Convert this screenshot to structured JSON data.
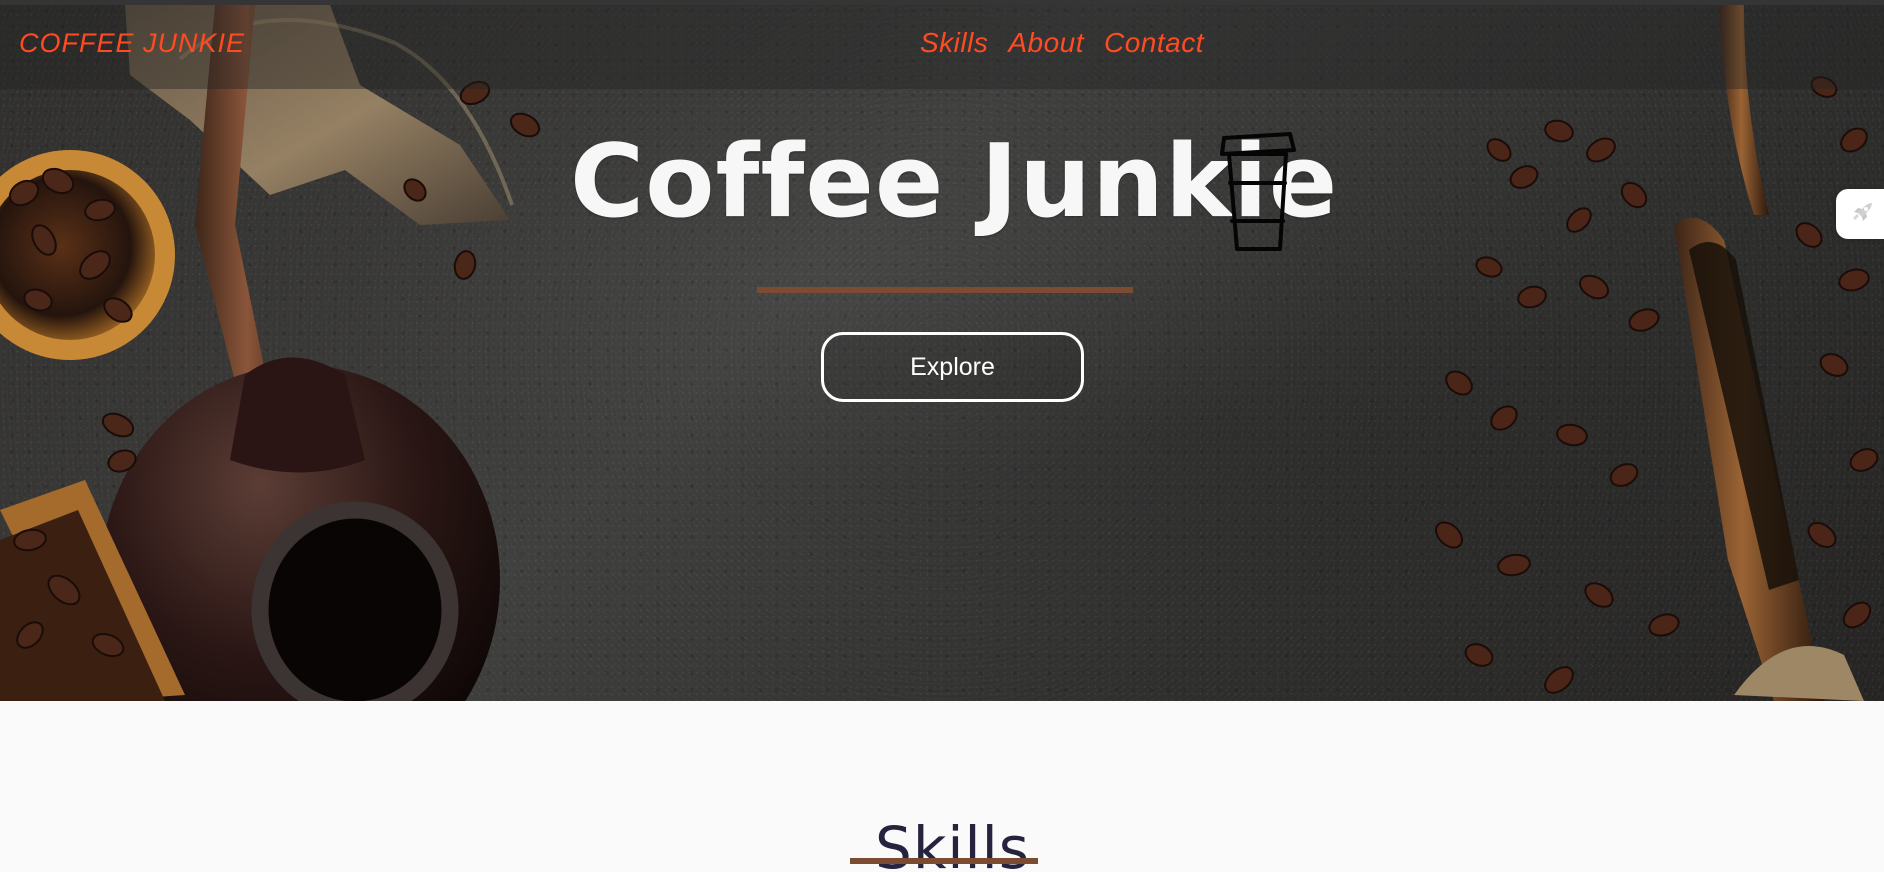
{
  "header": {
    "brand": "COFFEE JUNKIE",
    "nav": [
      {
        "label": "Skills"
      },
      {
        "label": "About"
      },
      {
        "label": "Contact"
      }
    ]
  },
  "hero": {
    "title": "Coffee Junkie",
    "button_label": "Explore",
    "icon": "coffee-cup-icon"
  },
  "sidebar": {
    "icon": "rocket-icon"
  },
  "skills": {
    "title": "Skills"
  },
  "colors": {
    "brand_orange": "#ff4b22",
    "accent_brown": "#7b4b32",
    "hero_text": "#f7f7f7",
    "section_title": "#25233d"
  }
}
